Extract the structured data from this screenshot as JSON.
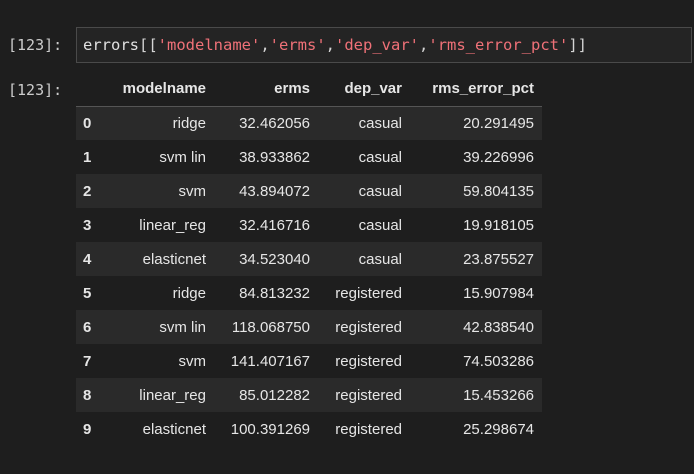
{
  "input_prompt": "[123]:",
  "output_prompt": "[123]:",
  "code": {
    "var": "errors",
    "open": "[[",
    "cols": [
      "'modelname'",
      "'erms'",
      "'dep_var'",
      "'rms_error_pct'"
    ],
    "sep": ",",
    "close": "]]"
  },
  "table": {
    "headers": [
      "modelname",
      "erms",
      "dep_var",
      "rms_error_pct"
    ],
    "rows": [
      {
        "idx": "0",
        "modelname": "ridge",
        "erms": "32.462056",
        "dep_var": "casual",
        "rms_error_pct": "20.291495"
      },
      {
        "idx": "1",
        "modelname": "svm lin",
        "erms": "38.933862",
        "dep_var": "casual",
        "rms_error_pct": "39.226996"
      },
      {
        "idx": "2",
        "modelname": "svm",
        "erms": "43.894072",
        "dep_var": "casual",
        "rms_error_pct": "59.804135"
      },
      {
        "idx": "3",
        "modelname": "linear_reg",
        "erms": "32.416716",
        "dep_var": "casual",
        "rms_error_pct": "19.918105"
      },
      {
        "idx": "4",
        "modelname": "elasticnet",
        "erms": "34.523040",
        "dep_var": "casual",
        "rms_error_pct": "23.875527"
      },
      {
        "idx": "5",
        "modelname": "ridge",
        "erms": "84.813232",
        "dep_var": "registered",
        "rms_error_pct": "15.907984"
      },
      {
        "idx": "6",
        "modelname": "svm lin",
        "erms": "118.068750",
        "dep_var": "registered",
        "rms_error_pct": "42.838540"
      },
      {
        "idx": "7",
        "modelname": "svm",
        "erms": "141.407167",
        "dep_var": "registered",
        "rms_error_pct": "74.503286"
      },
      {
        "idx": "8",
        "modelname": "linear_reg",
        "erms": "85.012282",
        "dep_var": "registered",
        "rms_error_pct": "15.453266"
      },
      {
        "idx": "9",
        "modelname": "elasticnet",
        "erms": "100.391269",
        "dep_var": "registered",
        "rms_error_pct": "25.298674"
      }
    ]
  }
}
